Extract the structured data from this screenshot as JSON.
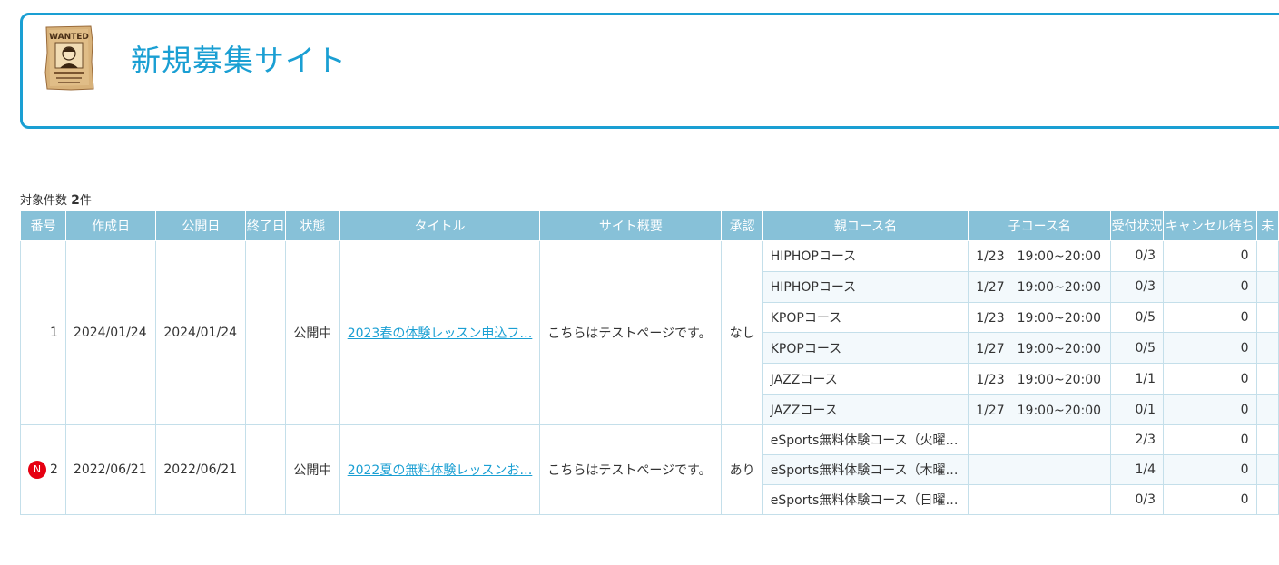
{
  "header": {
    "title": "新規募集サイト",
    "icon": "wanted-poster-icon"
  },
  "result": {
    "label": "対象件数",
    "count": "2",
    "unit": "件"
  },
  "table": {
    "columns": [
      "番号",
      "作成日",
      "公開日",
      "終了日",
      "状態",
      "タイトル",
      "サイト概要",
      "承認",
      "親コース名",
      "子コース名",
      "受付状況",
      "キャンセル待ち",
      "未"
    ],
    "rows": [
      {
        "no": "1",
        "created": "2024/01/24",
        "published": "2024/01/24",
        "ended": "",
        "status": "公開中",
        "title": "2023春の体験レッスン申込フ…",
        "summary": "こちらはテストページです。",
        "approval": "なし",
        "new": "",
        "courses": [
          {
            "parent": "HIPHOPコース",
            "child": "1/23　19:00~20:00",
            "reception": "0/3",
            "cancel_wait": "0"
          },
          {
            "parent": "HIPHOPコース",
            "child": "1/27　19:00~20:00",
            "reception": "0/3",
            "cancel_wait": "0"
          },
          {
            "parent": "KPOPコース",
            "child": "1/23　19:00~20:00",
            "reception": "0/5",
            "cancel_wait": "0"
          },
          {
            "parent": "KPOPコース",
            "child": "1/27　19:00~20:00",
            "reception": "0/5",
            "cancel_wait": "0"
          },
          {
            "parent": "JAZZコース",
            "child": "1/23　19:00~20:00",
            "reception": "1/1",
            "cancel_wait": "0"
          },
          {
            "parent": "JAZZコース",
            "child": "1/27　19:00~20:00",
            "reception": "0/1",
            "cancel_wait": "0"
          }
        ]
      },
      {
        "no": "2",
        "created": "2022/06/21",
        "published": "2022/06/21",
        "ended": "",
        "status": "公開中",
        "title": "2022夏の無料体験レッスンお…",
        "summary": "こちらはテストページです。",
        "approval": "あり",
        "new": "N",
        "courses": [
          {
            "parent": "eSports無料体験コース（火曜…",
            "child": "",
            "reception": "2/3",
            "cancel_wait": "0"
          },
          {
            "parent": "eSports無料体験コース（木曜…",
            "child": "",
            "reception": "1/4",
            "cancel_wait": "0"
          },
          {
            "parent": "eSports無料体験コース（日曜…",
            "child": "",
            "reception": "0/3",
            "cancel_wait": "0"
          }
        ]
      }
    ]
  },
  "colors": {
    "accent": "#1a9fd3",
    "header_bg": "#87c1d8",
    "new_badge": "#e60012"
  }
}
